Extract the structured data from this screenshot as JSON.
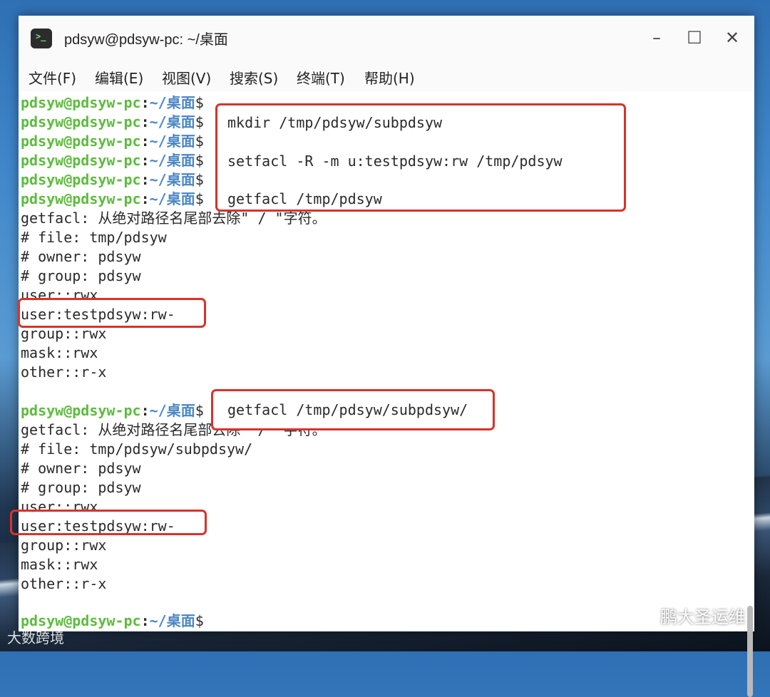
{
  "window": {
    "title": "pdsyw@pdsyw-pc: ~/桌面"
  },
  "icons": {
    "app": "terminal-icon",
    "minimize": "minimize-icon",
    "maximize": "maximize-icon",
    "close": "close-icon"
  },
  "menu": [
    "文件(F)",
    "编辑(E)",
    "视图(V)",
    "搜索(S)",
    "终端(T)",
    "帮助(H)"
  ],
  "prompt": {
    "user": "pdsyw@pdsyw-pc",
    "colon": ":",
    "path": "~/桌面",
    "dollar": "$"
  },
  "commands": {
    "mkdir": "mkdir /tmp/pdsyw/subpdsyw",
    "setfacl": "setfacl -R -m u:testpdsyw:rw /tmp/pdsyw",
    "getfacl1": "getfacl /tmp/pdsyw",
    "getfacl2": "getfacl /tmp/pdsyw/subpdsyw/"
  },
  "output1": [
    "getfacl: 从绝对路径名尾部去除\" / \"字符。",
    "# file: tmp/pdsyw",
    "# owner: pdsyw",
    "# group: pdsyw",
    "user::rwx",
    "user:testpdsyw:rw-",
    "group::rwx",
    "mask::rwx",
    "other::r-x"
  ],
  "output2": [
    "getfacl: 从绝对路径名尾部去除\" / \"字符。",
    "# file: tmp/pdsyw/subpdsyw/",
    "# owner: pdsyw",
    "# group: pdsyw",
    "user::rwx",
    "user:testpdsyw:rw-",
    "group::rwx",
    "mask::rwx",
    "other::r-x"
  ],
  "watermark": {
    "right": "鹏大圣运维",
    "left": "大数跨境"
  },
  "colors": {
    "prompt_user": "#5cbc3d",
    "prompt_path": "#4a86c6",
    "highlight": "#d9322a"
  }
}
